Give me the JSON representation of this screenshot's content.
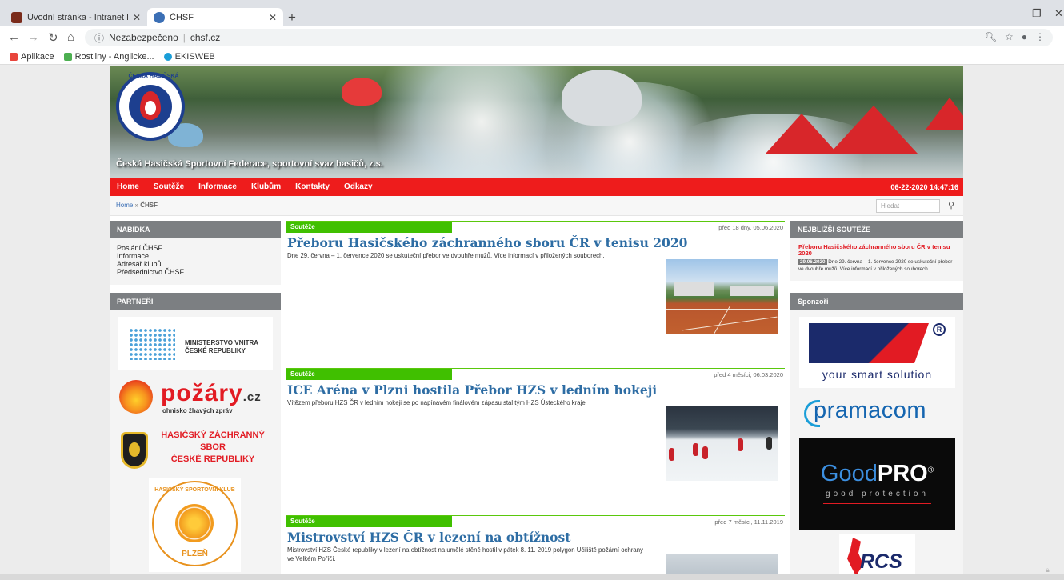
{
  "browser": {
    "tabs": [
      {
        "title": "Úvodní stránka - Intranet HZS Kr",
        "favicon_color": "#7a2b1b"
      },
      {
        "title": "ČHSF",
        "favicon_color": "#3b6fb5"
      }
    ],
    "new_tab": "+",
    "window_controls": [
      "–",
      "❐",
      "✕"
    ],
    "address": {
      "security": "Nezabezpečeno",
      "url": "chsf.cz"
    },
    "bookmarks": [
      {
        "label": "Aplikace",
        "color": "#e8453c"
      },
      {
        "label": "Rostliny - Anglicke...",
        "color": "#4caf50"
      },
      {
        "label": "EKISWEB",
        "color": "#1a9ed8"
      }
    ]
  },
  "site": {
    "tagline": "Česká Hasičská Sportovní Federace, sportovní svaz hasičů, z.s.",
    "logo_text": "ČESKÁ HASIČSKÁ",
    "menu": [
      "Home",
      "Soutěže",
      "Informace",
      "Klubům",
      "Kontakty",
      "Odkazy"
    ],
    "datetime": "06-22-2020 14:47:16",
    "breadcrumb": {
      "home": "Home",
      "sep": " » ",
      "current": "ČHSF"
    },
    "search_placeholder": "Hledat",
    "colors": {
      "menu_red": "#ee1c1c",
      "category_green": "#40c000",
      "title_blue": "#2e6da4"
    }
  },
  "left": {
    "menu_title": "NABÍDKA",
    "menu_items": [
      "Poslání ČHSF",
      "Informace",
      "Adresář klubů",
      "Předsednictvo ČHSF"
    ],
    "partners_title": "PARTNEŘI",
    "partners": {
      "mv": [
        "MINISTERSTVO VNITRA",
        "ČESKÉ REPUBLIKY"
      ],
      "pozary": {
        "word": "požáry",
        "tld": ".cz",
        "sub": "ohnisko žhavých zpráv"
      },
      "hzs": [
        "HASIČSKÝ ZÁCHRANNÝ",
        "SBOR",
        "ČESKÉ REPUBLIKY"
      ],
      "hsk": {
        "top": "HASIČSKÝ SPORTOVNÍ KLUB",
        "bottom": "PLZEŇ"
      }
    }
  },
  "articles": [
    {
      "category": "Soutěže",
      "date": "před 18 dny, 05.06.2020",
      "title": "Přeboru Hasičského záchranného sboru ČR v tenisu 2020",
      "perex": "Dne 29. června – 1. července 2020 se uskuteční přebor ve dvouhře mužů. Více informací v přiložených souborech."
    },
    {
      "category": "Soutěže",
      "date": "před 4 měsíci, 06.03.2020",
      "title": "ICE Aréna v Plzni hostila Přebor HZS v ledním hokeji",
      "perex": "Vítězem přeboru HZS ČR v ledním hokeji se po napínavém finálovém zápasu stal tým HZS Ústeckého kraje"
    },
    {
      "category": "Soutěže",
      "date": "před 7 měsíci, 11.11.2019",
      "title": "Mistrovství HZS ČR v lezení na obtížnost",
      "perex": "Mistrovství HZS České republiky v lezení na obtížnost na umělé stěně hostil v pátek 8. 11. 2019 polygon Učiliště požární ochrany ve Velkém Poříčí."
    }
  ],
  "right": {
    "next_title": "NEJBLIŽŠÍ SOUTĚŽE",
    "next_link": "Přeboru Hasičského záchranného sboru ČR v tenisu 2020",
    "next_date": "29.06.2020",
    "next_text": "Dne 29. června – 1. července 2020 se uskuteční přebor ve dvouhře mužů. Více informací v přiložených souborech.",
    "sponsors_title": "Sponzoři",
    "sponsors": {
      "deva_slogan": "your smart solution",
      "deva_reg": "R",
      "pramacom": "pramacom",
      "goodpro": {
        "good": "Good",
        "pro": "PRO",
        "reg": "®",
        "sub": "good protection"
      },
      "rcs": "RCS"
    }
  }
}
